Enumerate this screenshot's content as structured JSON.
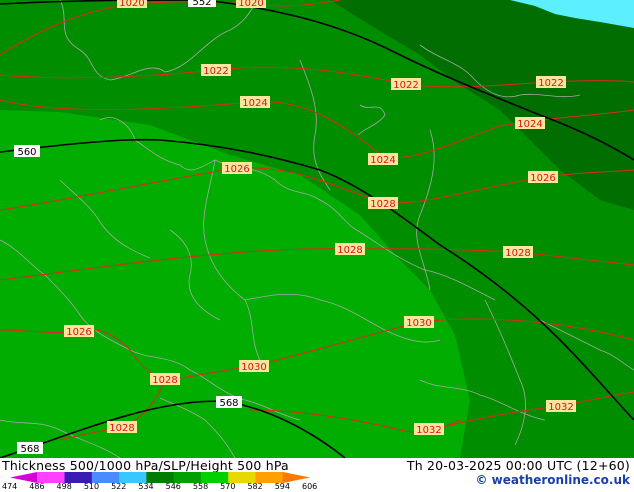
{
  "map": {
    "thickness_labels": [
      "552",
      "560",
      "568",
      "568"
    ],
    "pressure_labels": [
      "1020",
      "1020",
      "1022",
      "1022",
      "1022",
      "1024",
      "1024",
      "1024",
      "1026",
      "1026",
      "1028",
      "1028",
      "1028",
      "1026",
      "1030",
      "1028",
      "1030",
      "1028",
      "1032",
      "1032"
    ]
  },
  "footer": {
    "title": "Thickness 500/1000 hPa/SLP/Height 500 hPa",
    "datetime": "Th 20-03-2025 00:00 UTC (12+60)",
    "credit": "© weatheronline.co.uk"
  },
  "legend": {
    "values": [
      "474",
      "486",
      "498",
      "510",
      "522",
      "534",
      "546",
      "558",
      "570",
      "582",
      "594",
      "606"
    ],
    "colors": [
      "#d800d8",
      "#ff40ff",
      "#3a1bb5",
      "#4a8cff",
      "#38c8ff",
      "#007d00",
      "#00a000",
      "#00d000",
      "#e8d800",
      "#ffa000",
      "#ff7800"
    ]
  },
  "colors": {
    "land_dark": "#006e00",
    "land_mid": "#008d00",
    "land_light": "#00ad00",
    "sea": "#5cf0ff",
    "isobar": "#e0281e",
    "thickness_line": "#000000",
    "borders": "#a8a8a8"
  }
}
